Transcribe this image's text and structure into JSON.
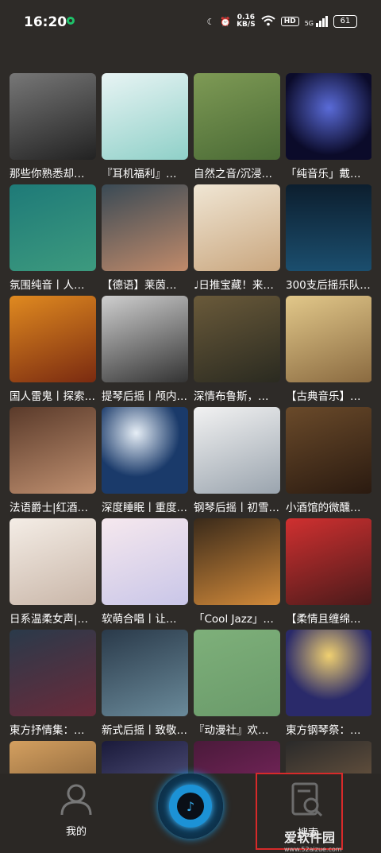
{
  "status": {
    "time": "16:20",
    "speed_value": "0.16",
    "speed_unit": "KB/S",
    "hd": "HD",
    "signal": "5G",
    "battery": "61"
  },
  "playlists": [
    {
      "title": "那些你熟悉却…"
    },
    {
      "title": "『耳机福利』…"
    },
    {
      "title": "自然之音/沉浸…"
    },
    {
      "title": "「纯音乐」戴…"
    },
    {
      "title": "氛围纯音丨人…"
    },
    {
      "title": "【德语】莱茵…"
    },
    {
      "title": "♩日推宝藏！来…"
    },
    {
      "title": "300支后摇乐队…"
    },
    {
      "title": "国人雷鬼丨探索…"
    },
    {
      "title": "提琴后摇丨颅内…"
    },
    {
      "title": "深情布鲁斯，…"
    },
    {
      "title": "【古典音乐】…"
    },
    {
      "title": "法语爵士|红酒…"
    },
    {
      "title": "深度睡眠丨重度…"
    },
    {
      "title": "钢琴后摇丨初雪…"
    },
    {
      "title": "小酒馆的微醺…"
    },
    {
      "title": "日系温柔女声|…"
    },
    {
      "title": "软萌合唱丨让…"
    },
    {
      "title": "「Cool Jazz」…"
    },
    {
      "title": "【柔情且缠绵…"
    },
    {
      "title": "東方抒情集：…"
    },
    {
      "title": "新式后摇丨致敬…"
    },
    {
      "title": "『动漫社』欢…"
    },
    {
      "title": "東方钢琴祭：…"
    },
    {
      "title": ""
    },
    {
      "title": ""
    },
    {
      "title": ""
    },
    {
      "title": ""
    }
  ],
  "nav": {
    "mine_label": "我的",
    "search_label": "搜索"
  },
  "watermark": {
    "main": "爱软件园",
    "sub": "www.52aizue.com"
  }
}
